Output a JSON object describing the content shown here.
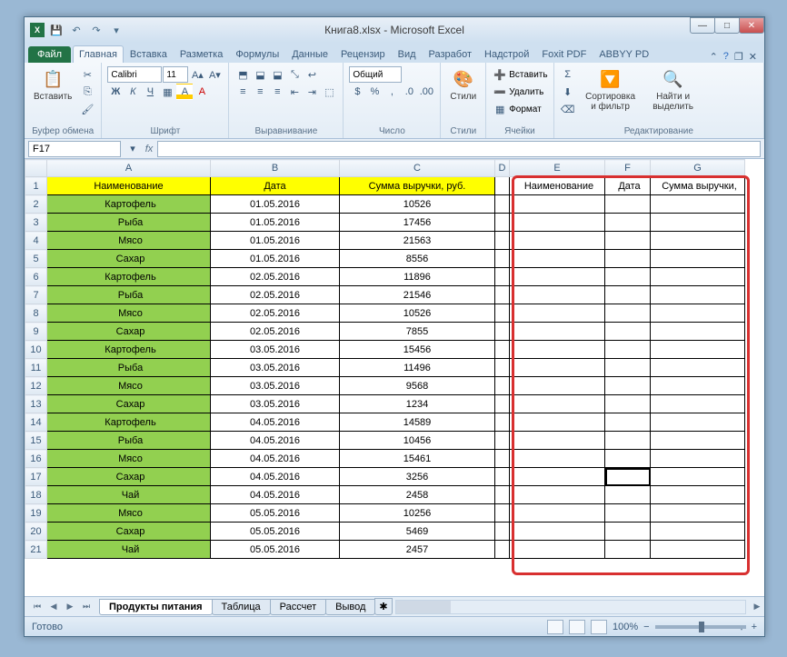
{
  "title": "Книга8.xlsx - Microsoft Excel",
  "tabs": {
    "file": "Файл",
    "home": "Главная",
    "insert": "Вставка",
    "layout": "Разметка",
    "formulas": "Формулы",
    "data": "Данные",
    "review": "Рецензир",
    "view": "Вид",
    "dev": "Разработ",
    "addins": "Надстрой",
    "foxit": "Foxit PDF",
    "abbyy": "ABBYY PD"
  },
  "ribbon": {
    "clipboard": "Буфер обмена",
    "paste": "Вставить",
    "font": "Шрифт",
    "font_name": "Calibri",
    "font_size": "11",
    "alignment": "Выравнивание",
    "number": "Число",
    "number_fmt": "Общий",
    "styles": "Стили",
    "styles_btn": "Стили",
    "cells": "Ячейки",
    "insert_c": "Вставить",
    "delete_c": "Удалить",
    "format_c": "Формат",
    "editing": "Редактирование",
    "sort": "Сортировка и фильтр",
    "find": "Найти и выделить"
  },
  "namebox": "F17",
  "headers1": {
    "a": "Наименование",
    "b": "Дата",
    "c": "Сумма выручки, руб."
  },
  "headers2": {
    "e": "Наименование",
    "f": "Дата",
    "g": "Сумма выручки,"
  },
  "rows": [
    {
      "a": "Картофель",
      "b": "01.05.2016",
      "c": "10526"
    },
    {
      "a": "Рыба",
      "b": "01.05.2016",
      "c": "17456"
    },
    {
      "a": "Мясо",
      "b": "01.05.2016",
      "c": "21563"
    },
    {
      "a": "Сахар",
      "b": "01.05.2016",
      "c": "8556"
    },
    {
      "a": "Картофель",
      "b": "02.05.2016",
      "c": "11896"
    },
    {
      "a": "Рыба",
      "b": "02.05.2016",
      "c": "21546"
    },
    {
      "a": "Мясо",
      "b": "02.05.2016",
      "c": "10526"
    },
    {
      "a": "Сахар",
      "b": "02.05.2016",
      "c": "7855"
    },
    {
      "a": "Картофель",
      "b": "03.05.2016",
      "c": "15456"
    },
    {
      "a": "Рыба",
      "b": "03.05.2016",
      "c": "11496"
    },
    {
      "a": "Мясо",
      "b": "03.05.2016",
      "c": "9568"
    },
    {
      "a": "Сахар",
      "b": "03.05.2016",
      "c": "1234"
    },
    {
      "a": "Картофель",
      "b": "04.05.2016",
      "c": "14589"
    },
    {
      "a": "Рыба",
      "b": "04.05.2016",
      "c": "10456"
    },
    {
      "a": "Мясо",
      "b": "04.05.2016",
      "c": "15461"
    },
    {
      "a": "Сахар",
      "b": "04.05.2016",
      "c": "3256"
    },
    {
      "a": "Чай",
      "b": "04.05.2016",
      "c": "2458"
    },
    {
      "a": "Мясо",
      "b": "05.05.2016",
      "c": "10256"
    },
    {
      "a": "Сахар",
      "b": "05.05.2016",
      "c": "5469"
    },
    {
      "a": "Чай",
      "b": "05.05.2016",
      "c": "2457"
    }
  ],
  "sheets": {
    "s1": "Продукты питания",
    "s2": "Таблица",
    "s3": "Рассчет",
    "s4": "Вывод"
  },
  "status": "Готово",
  "zoom": "100%"
}
